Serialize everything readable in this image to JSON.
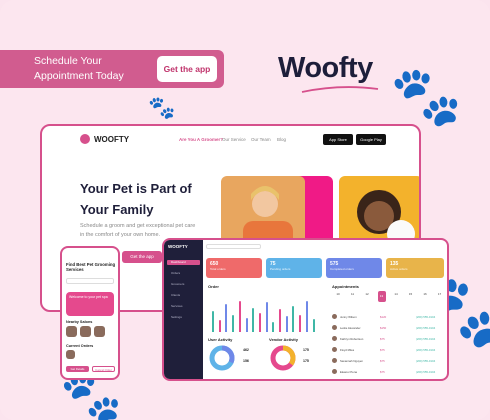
{
  "banner": {
    "text": "Schedule Your Appointment Today",
    "button": "Get the app"
  },
  "brand": {
    "name": "Woofty"
  },
  "website": {
    "logo": "WOOFTY",
    "nav": [
      "Are You A Groomer?",
      "Our Service",
      "Our Team",
      "Blog"
    ],
    "stores": [
      "App Store",
      "Google Play"
    ],
    "hero_title": "Your Pet is Part of Your Family",
    "hero_subtitle": "Schedule a groom and get exceptional pet care in the comfort of your own home.",
    "hero_button": "Get the app"
  },
  "phone": {
    "title": "Find Best Pet Grooming Services",
    "promo": "Welcome to your pet spa",
    "section1": "Nearby Salons",
    "section2": "Current Orders",
    "btn1": "Get Details",
    "btn2": "Cancel Order"
  },
  "dashboard": {
    "logo": "WOOFTY",
    "menu": [
      "Dashboard",
      "Orders",
      "Groomers",
      "Clients",
      "Services",
      "Settings"
    ],
    "stats": [
      {
        "value": "650",
        "label": "Total orders",
        "color": "#ef6a6a"
      },
      {
        "value": "75",
        "label": "Pending orders",
        "color": "#5fb3e8"
      },
      {
        "value": "575",
        "label": "Completed orders",
        "color": "#6f88e8"
      },
      {
        "value": "135",
        "label": "Active orders",
        "color": "#e8b44a"
      }
    ],
    "order_title": "Order",
    "user_activity": {
      "title": "User Activity",
      "a": "462",
      "b": "156"
    },
    "vendor_activity": {
      "title": "Vendor Activity",
      "a": "175",
      "b": "175"
    },
    "appointments_title": "Appointments",
    "days": [
      "10",
      "11",
      "12",
      "13",
      "14",
      "15",
      "16",
      "17"
    ],
    "selected_day": "13",
    "appointments": [
      {
        "name": "Jenny Wilson",
        "price": "$120",
        "phone": "(209) 555-0104"
      },
      {
        "name": "Leslie Alexander",
        "price": "$150",
        "phone": "(209) 555-0104"
      },
      {
        "name": "Kathryn Robertson",
        "price": "$75",
        "phone": "(209) 555-0104"
      },
      {
        "name": "Floyd Miles",
        "price": "$75",
        "phone": "(209) 555-0104"
      },
      {
        "name": "Savannah Nguyen",
        "price": "$75",
        "phone": "(209) 555-0104"
      },
      {
        "name": "Eleanor Pena",
        "price": "$75",
        "phone": "(209) 555-0104"
      }
    ],
    "bars": [
      60,
      35,
      80,
      50,
      90,
      40,
      70,
      55,
      85,
      30,
      65,
      45,
      75,
      50,
      88,
      38
    ]
  },
  "colors": {
    "accent": "#d6508c",
    "background": "#fce6ef",
    "sidebar": "#1f1f3a"
  }
}
